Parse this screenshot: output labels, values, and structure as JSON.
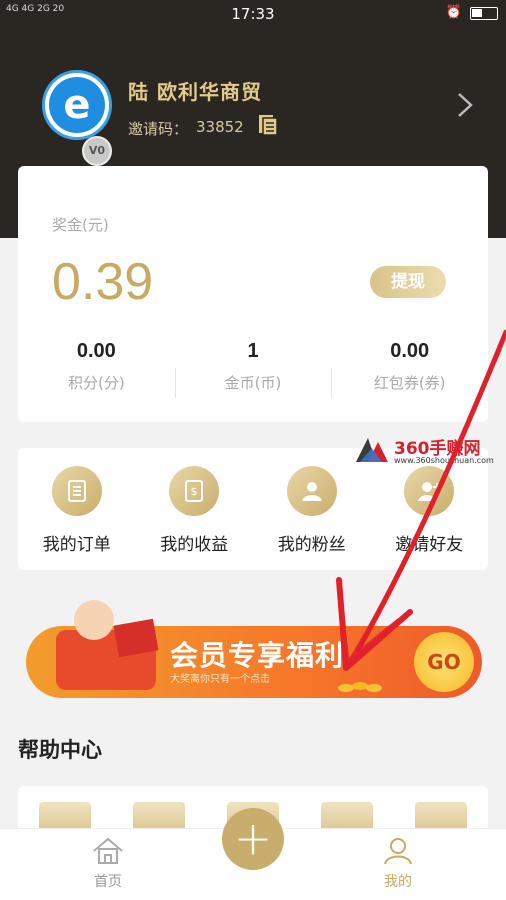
{
  "status_bar": {
    "time": "17:33",
    "signal": "4G 4G 2G 20"
  },
  "profile": {
    "avatar_letter": "e",
    "vip_badge": "V0",
    "name": "陆  欧利华商贸",
    "invite_label": "邀请码：",
    "invite_code": "33852"
  },
  "wallet": {
    "bonus_label": "奖金(元)",
    "bonus_value": "0.39",
    "withdraw_label": "提现",
    "stats": [
      {
        "value": "0.00",
        "label": "积分(分)"
      },
      {
        "value": "1",
        "label": "金币(币)"
      },
      {
        "value": "0.00",
        "label": "红包券(券)"
      }
    ]
  },
  "menu": {
    "items": [
      {
        "label": "我的订单",
        "icon": "order-icon"
      },
      {
        "label": "我的收益",
        "icon": "income-icon"
      },
      {
        "label": "我的粉丝",
        "icon": "fans-icon"
      },
      {
        "label": "邀请好友",
        "icon": "invite-icon"
      }
    ]
  },
  "watermark": {
    "title": "360手赚网",
    "url": "www.360shouzhuan.com"
  },
  "banner": {
    "title": "会员专享福利",
    "subtitle": "大奖离你只有一个点击",
    "go_label": "GO"
  },
  "help": {
    "title": "帮助中心"
  },
  "tabbar": {
    "home_label": "首页",
    "plus_label": "+",
    "mine_label": "我的"
  },
  "colors": {
    "gold": "#c8aa64",
    "header_bg": "#2a2723",
    "arrow": "#e0202a"
  }
}
